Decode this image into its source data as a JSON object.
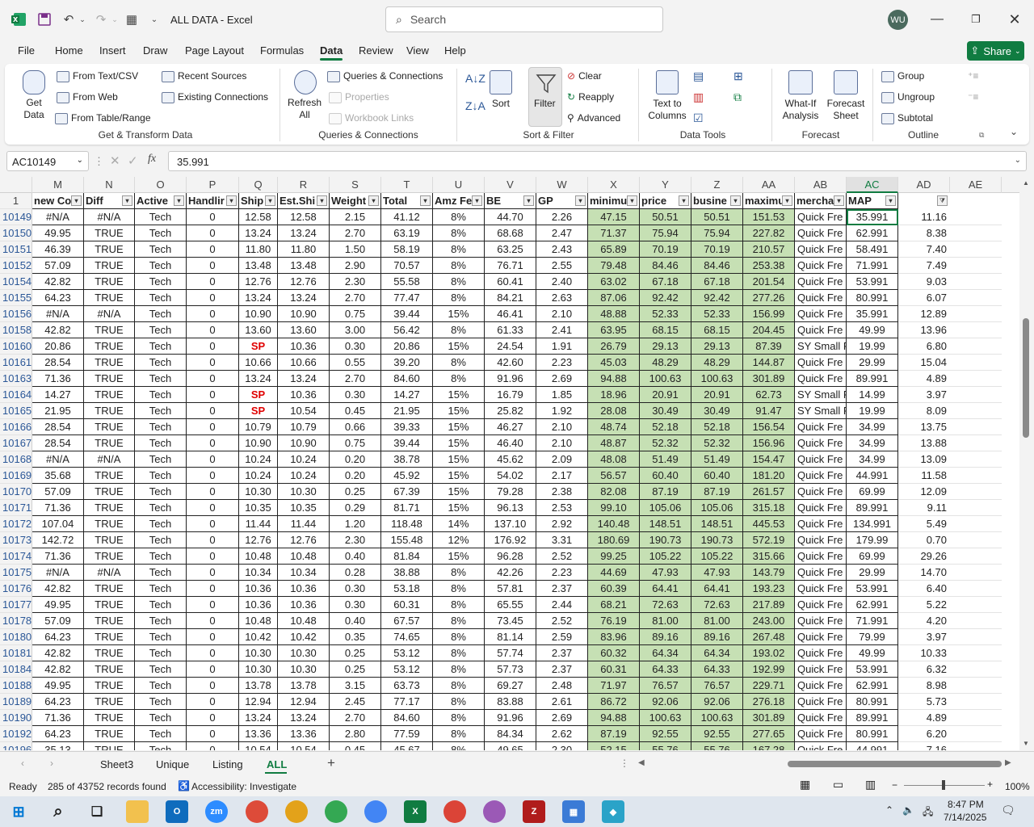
{
  "app": {
    "title": "ALL DATA - Excel",
    "search_placeholder": "Search",
    "user_initials": "WU"
  },
  "menu_tabs": [
    "File",
    "Home",
    "Insert",
    "Draw",
    "Page Layout",
    "Formulas",
    "Data",
    "Review",
    "View",
    "Help"
  ],
  "share_label": "Share",
  "ribbon": {
    "get_data": "Get\nData",
    "from_text_csv": "From Text/CSV",
    "from_web": "From Web",
    "from_table_range": "From Table/Range",
    "recent_sources": "Recent Sources",
    "existing_connections": "Existing Connections",
    "group_get_transform": "Get & Transform Data",
    "refresh_all": "Refresh\nAll",
    "queries_connections": "Queries & Connections",
    "properties": "Properties",
    "workbook_links": "Workbook Links",
    "group_queries": "Queries & Connections",
    "sort": "Sort",
    "filter": "Filter",
    "clear": "Clear",
    "reapply": "Reapply",
    "advanced": "Advanced",
    "group_sort_filter": "Sort & Filter",
    "text_to_columns": "Text to\nColumns",
    "group_data_tools": "Data Tools",
    "what_if": "What-If\nAnalysis",
    "forecast_sheet": "Forecast\nSheet",
    "group_forecast": "Forecast",
    "group_btn": "Group",
    "ungroup": "Ungroup",
    "subtotal": "Subtotal",
    "group_outline": "Outline"
  },
  "name_box": "AC10149",
  "formula_value": "35.991",
  "columns": [
    "M",
    "N",
    "O",
    "P",
    "Q",
    "R",
    "S",
    "T",
    "U",
    "V",
    "W",
    "X",
    "Y",
    "Z",
    "AA",
    "AB",
    "AC",
    "AD",
    "AE"
  ],
  "header_row_num": "1",
  "headers": [
    "new Co",
    "Diff",
    "Active",
    "Handlir",
    "Ship",
    "Est.Shi",
    "Weight",
    "Total",
    "Amz Fe",
    "BE",
    "GP",
    "minimu",
    "price",
    "busine",
    "maximu",
    "mercha",
    "MAP"
  ],
  "rows": [
    [
      "10149",
      "#N/A",
      "#N/A",
      "Tech",
      "0",
      "12.58",
      "12.58",
      "2.15",
      "41.12",
      "8%",
      "44.70",
      "2.26",
      "47.15",
      "50.51",
      "50.51",
      "151.53",
      "Quick Fre",
      "35.991",
      "11.16"
    ],
    [
      "10150",
      "49.95",
      "TRUE",
      "Tech",
      "0",
      "13.24",
      "13.24",
      "2.70",
      "63.19",
      "8%",
      "68.68",
      "2.47",
      "71.37",
      "75.94",
      "75.94",
      "227.82",
      "Quick Fre",
      "62.991",
      "8.38"
    ],
    [
      "10151",
      "46.39",
      "TRUE",
      "Tech",
      "0",
      "11.80",
      "11.80",
      "1.50",
      "58.19",
      "8%",
      "63.25",
      "2.43",
      "65.89",
      "70.19",
      "70.19",
      "210.57",
      "Quick Fre",
      "58.491",
      "7.40"
    ],
    [
      "10152",
      "57.09",
      "TRUE",
      "Tech",
      "0",
      "13.48",
      "13.48",
      "2.90",
      "70.57",
      "8%",
      "76.71",
      "2.55",
      "79.48",
      "84.46",
      "84.46",
      "253.38",
      "Quick Fre",
      "71.991",
      "7.49"
    ],
    [
      "10154",
      "42.82",
      "TRUE",
      "Tech",
      "0",
      "12.76",
      "12.76",
      "2.30",
      "55.58",
      "8%",
      "60.41",
      "2.40",
      "63.02",
      "67.18",
      "67.18",
      "201.54",
      "Quick Fre",
      "53.991",
      "9.03"
    ],
    [
      "10155",
      "64.23",
      "TRUE",
      "Tech",
      "0",
      "13.24",
      "13.24",
      "2.70",
      "77.47",
      "8%",
      "84.21",
      "2.63",
      "87.06",
      "92.42",
      "92.42",
      "277.26",
      "Quick Fre",
      "80.991",
      "6.07"
    ],
    [
      "10156",
      "#N/A",
      "#N/A",
      "Tech",
      "0",
      "10.90",
      "10.90",
      "0.75",
      "39.44",
      "15%",
      "46.41",
      "2.10",
      "48.88",
      "52.33",
      "52.33",
      "156.99",
      "Quick Fre",
      "35.991",
      "12.89"
    ],
    [
      "10158",
      "42.82",
      "TRUE",
      "Tech",
      "0",
      "13.60",
      "13.60",
      "3.00",
      "56.42",
      "8%",
      "61.33",
      "2.41",
      "63.95",
      "68.15",
      "68.15",
      "204.45",
      "Quick Fre",
      "49.99",
      "13.96"
    ],
    [
      "10160",
      "20.86",
      "TRUE",
      "Tech",
      "0",
      "SP",
      "10.36",
      "0.30",
      "20.86",
      "15%",
      "24.54",
      "1.91",
      "26.79",
      "29.13",
      "29.13",
      "87.39",
      "SY Small P",
      "19.99",
      "6.80"
    ],
    [
      "10161",
      "28.54",
      "TRUE",
      "Tech",
      "0",
      "10.66",
      "10.66",
      "0.55",
      "39.20",
      "8%",
      "42.60",
      "2.23",
      "45.03",
      "48.29",
      "48.29",
      "144.87",
      "Quick Fre",
      "29.99",
      "15.04"
    ],
    [
      "10163",
      "71.36",
      "TRUE",
      "Tech",
      "0",
      "13.24",
      "13.24",
      "2.70",
      "84.60",
      "8%",
      "91.96",
      "2.69",
      "94.88",
      "100.63",
      "100.63",
      "301.89",
      "Quick Fre",
      "89.991",
      "4.89"
    ],
    [
      "10164",
      "14.27",
      "TRUE",
      "Tech",
      "0",
      "SP",
      "10.36",
      "0.30",
      "14.27",
      "15%",
      "16.79",
      "1.85",
      "18.96",
      "20.91",
      "20.91",
      "62.73",
      "SY Small P",
      "14.99",
      "3.97"
    ],
    [
      "10165",
      "21.95",
      "TRUE",
      "Tech",
      "0",
      "SP",
      "10.54",
      "0.45",
      "21.95",
      "15%",
      "25.82",
      "1.92",
      "28.08",
      "30.49",
      "30.49",
      "91.47",
      "SY Small P",
      "19.99",
      "8.09"
    ],
    [
      "10166",
      "28.54",
      "TRUE",
      "Tech",
      "0",
      "10.79",
      "10.79",
      "0.66",
      "39.33",
      "15%",
      "46.27",
      "2.10",
      "48.74",
      "52.18",
      "52.18",
      "156.54",
      "Quick Fre",
      "34.99",
      "13.75"
    ],
    [
      "10167",
      "28.54",
      "TRUE",
      "Tech",
      "0",
      "10.90",
      "10.90",
      "0.75",
      "39.44",
      "15%",
      "46.40",
      "2.10",
      "48.87",
      "52.32",
      "52.32",
      "156.96",
      "Quick Fre",
      "34.99",
      "13.88"
    ],
    [
      "10168",
      "#N/A",
      "#N/A",
      "Tech",
      "0",
      "10.24",
      "10.24",
      "0.20",
      "38.78",
      "15%",
      "45.62",
      "2.09",
      "48.08",
      "51.49",
      "51.49",
      "154.47",
      "Quick Fre",
      "34.99",
      "13.09"
    ],
    [
      "10169",
      "35.68",
      "TRUE",
      "Tech",
      "0",
      "10.24",
      "10.24",
      "0.20",
      "45.92",
      "15%",
      "54.02",
      "2.17",
      "56.57",
      "60.40",
      "60.40",
      "181.20",
      "Quick Fre",
      "44.991",
      "11.58"
    ],
    [
      "10170",
      "57.09",
      "TRUE",
      "Tech",
      "0",
      "10.30",
      "10.30",
      "0.25",
      "67.39",
      "15%",
      "79.28",
      "2.38",
      "82.08",
      "87.19",
      "87.19",
      "261.57",
      "Quick Fre",
      "69.99",
      "12.09"
    ],
    [
      "10171",
      "71.36",
      "TRUE",
      "Tech",
      "0",
      "10.35",
      "10.35",
      "0.29",
      "81.71",
      "15%",
      "96.13",
      "2.53",
      "99.10",
      "105.06",
      "105.06",
      "315.18",
      "Quick Fre",
      "89.991",
      "9.11"
    ],
    [
      "10172",
      "107.04",
      "TRUE",
      "Tech",
      "0",
      "11.44",
      "11.44",
      "1.20",
      "118.48",
      "14%",
      "137.10",
      "2.92",
      "140.48",
      "148.51",
      "148.51",
      "445.53",
      "Quick Fre",
      "134.991",
      "5.49"
    ],
    [
      "10173",
      "142.72",
      "TRUE",
      "Tech",
      "0",
      "12.76",
      "12.76",
      "2.30",
      "155.48",
      "12%",
      "176.92",
      "3.31",
      "180.69",
      "190.73",
      "190.73",
      "572.19",
      "Quick Fre",
      "179.99",
      "0.70"
    ],
    [
      "10174",
      "71.36",
      "TRUE",
      "Tech",
      "0",
      "10.48",
      "10.48",
      "0.40",
      "81.84",
      "15%",
      "96.28",
      "2.52",
      "99.25",
      "105.22",
      "105.22",
      "315.66",
      "Quick Fre",
      "69.99",
      "29.26"
    ],
    [
      "10175",
      "#N/A",
      "#N/A",
      "Tech",
      "0",
      "10.34",
      "10.34",
      "0.28",
      "38.88",
      "8%",
      "42.26",
      "2.23",
      "44.69",
      "47.93",
      "47.93",
      "143.79",
      "Quick Fre",
      "29.99",
      "14.70"
    ],
    [
      "10176",
      "42.82",
      "TRUE",
      "Tech",
      "0",
      "10.36",
      "10.36",
      "0.30",
      "53.18",
      "8%",
      "57.81",
      "2.37",
      "60.39",
      "64.41",
      "64.41",
      "193.23",
      "Quick Fre",
      "53.991",
      "6.40"
    ],
    [
      "10177",
      "49.95",
      "TRUE",
      "Tech",
      "0",
      "10.36",
      "10.36",
      "0.30",
      "60.31",
      "8%",
      "65.55",
      "2.44",
      "68.21",
      "72.63",
      "72.63",
      "217.89",
      "Quick Fre",
      "62.991",
      "5.22"
    ],
    [
      "10178",
      "57.09",
      "TRUE",
      "Tech",
      "0",
      "10.48",
      "10.48",
      "0.40",
      "67.57",
      "8%",
      "73.45",
      "2.52",
      "76.19",
      "81.00",
      "81.00",
      "243.00",
      "Quick Fre",
      "71.991",
      "4.20"
    ],
    [
      "10180",
      "64.23",
      "TRUE",
      "Tech",
      "0",
      "10.42",
      "10.42",
      "0.35",
      "74.65",
      "8%",
      "81.14",
      "2.59",
      "83.96",
      "89.16",
      "89.16",
      "267.48",
      "Quick Fre",
      "79.99",
      "3.97"
    ],
    [
      "10181",
      "42.82",
      "TRUE",
      "Tech",
      "0",
      "10.30",
      "10.30",
      "0.25",
      "53.12",
      "8%",
      "57.74",
      "2.37",
      "60.32",
      "64.34",
      "64.34",
      "193.02",
      "Quick Fre",
      "49.99",
      "10.33"
    ],
    [
      "10184",
      "42.82",
      "TRUE",
      "Tech",
      "0",
      "10.30",
      "10.30",
      "0.25",
      "53.12",
      "8%",
      "57.73",
      "2.37",
      "60.31",
      "64.33",
      "64.33",
      "192.99",
      "Quick Fre",
      "53.991",
      "6.32"
    ],
    [
      "10188",
      "49.95",
      "TRUE",
      "Tech",
      "0",
      "13.78",
      "13.78",
      "3.15",
      "63.73",
      "8%",
      "69.27",
      "2.48",
      "71.97",
      "76.57",
      "76.57",
      "229.71",
      "Quick Fre",
      "62.991",
      "8.98"
    ],
    [
      "10189",
      "64.23",
      "TRUE",
      "Tech",
      "0",
      "12.94",
      "12.94",
      "2.45",
      "77.17",
      "8%",
      "83.88",
      "2.61",
      "86.72",
      "92.06",
      "92.06",
      "276.18",
      "Quick Fre",
      "80.991",
      "5.73"
    ],
    [
      "10190",
      "71.36",
      "TRUE",
      "Tech",
      "0",
      "13.24",
      "13.24",
      "2.70",
      "84.60",
      "8%",
      "91.96",
      "2.69",
      "94.88",
      "100.63",
      "100.63",
      "301.89",
      "Quick Fre",
      "89.991",
      "4.89"
    ],
    [
      "10192",
      "64.23",
      "TRUE",
      "Tech",
      "0",
      "13.36",
      "13.36",
      "2.80",
      "77.59",
      "8%",
      "84.34",
      "2.62",
      "87.19",
      "92.55",
      "92.55",
      "277.65",
      "Quick Fre",
      "80.991",
      "6.20"
    ],
    [
      "10196",
      "35.13",
      "TRUE",
      "Tech",
      "0",
      "10.54",
      "10.54",
      "0.45",
      "45.67",
      "8%",
      "49.65",
      "2.30",
      "52.15",
      "55.76",
      "55.76",
      "167.28",
      "Quick Fre",
      "44.991",
      "7.16"
    ]
  ],
  "sheet_tabs": [
    "Sheet3",
    "Unique",
    "Listing",
    "ALL"
  ],
  "status": {
    "ready": "Ready",
    "records": "285 of 43752 records found",
    "accessibility": "Accessibility: Investigate",
    "zoom": "100%"
  },
  "clock": {
    "time": "8:47 PM",
    "date": "7/14/2025"
  },
  "colors": {
    "excel_green": "#107c41",
    "filtered_fill": "#c6e0b4",
    "sp_red": "#e00000"
  }
}
